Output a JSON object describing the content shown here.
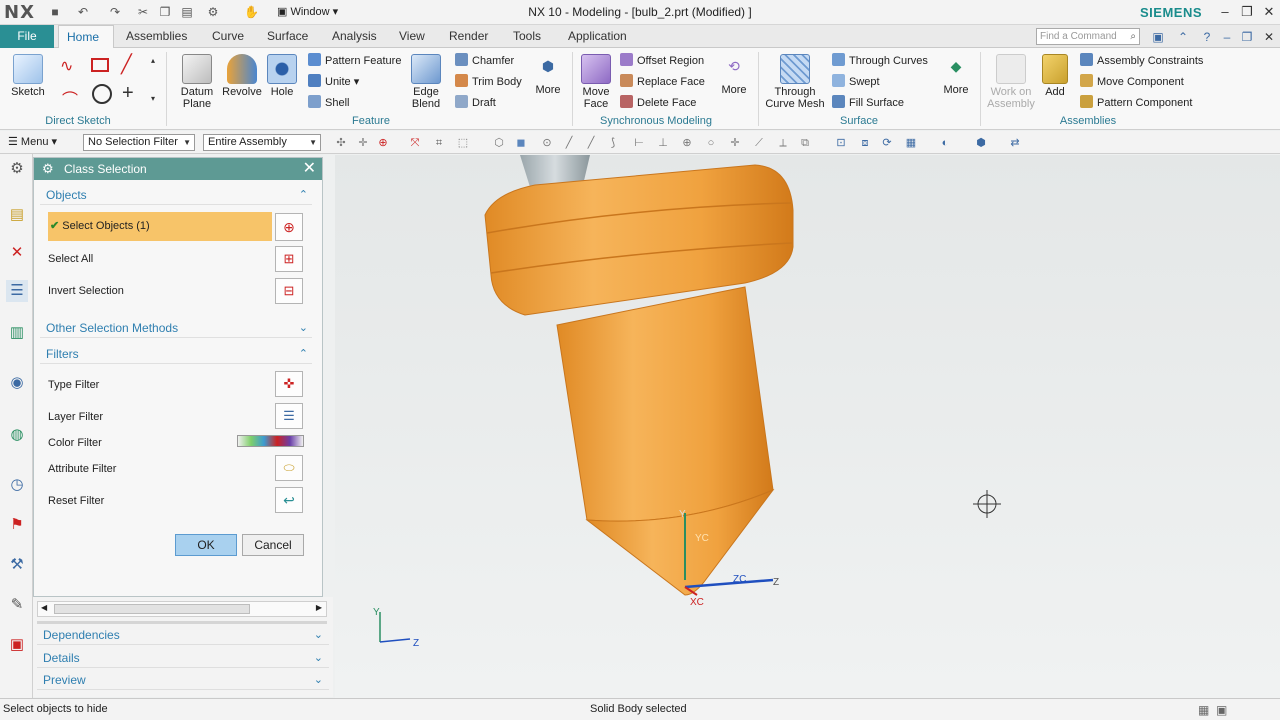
{
  "app": {
    "logo": "NX",
    "window_menu": "Window",
    "title": "NX 10 - Modeling - [bulb_2.prt (Modified) ]",
    "brand": "SIEMENS",
    "accent_color": "#2a8f94"
  },
  "tabs": {
    "file": "File",
    "items": [
      "Home",
      "Assemblies",
      "Curve",
      "Surface",
      "Analysis",
      "View",
      "Render",
      "Tools",
      "Application"
    ],
    "active": "Home",
    "command_finder_placeholder": "Find a Command"
  },
  "ribbon": {
    "direct_sketch": {
      "sketch": "Sketch",
      "group": "Direct Sketch"
    },
    "feature": {
      "datum_plane": "Datum Plane",
      "revolve": "Revolve",
      "hole": "Hole",
      "pattern_feature": "Pattern Feature",
      "unite": "Unite",
      "shell": "Shell",
      "edge_blend": "Edge Blend",
      "chamfer": "Chamfer",
      "trim_body": "Trim Body",
      "draft": "Draft",
      "more": "More",
      "group": "Feature"
    },
    "sync": {
      "move_face": "Move Face",
      "offset_region": "Offset Region",
      "replace_face": "Replace Face",
      "delete_face": "Delete Face",
      "more": "More",
      "group": "Synchronous Modeling"
    },
    "surface": {
      "through_curve_mesh": "Through Curve Mesh",
      "through_curves": "Through Curves",
      "swept": "Swept",
      "fill_surface": "Fill Surface",
      "more": "More",
      "group": "Surface"
    },
    "assemblies": {
      "work_on_assembly": "Work on Assembly",
      "add": "Add",
      "assembly_constraints": "Assembly Constraints",
      "move_component": "Move Component",
      "pattern_component": "Pattern Component",
      "group": "Assemblies"
    }
  },
  "selection_bar": {
    "menu": "Menu",
    "filter": "No Selection Filter",
    "scope": "Entire Assembly"
  },
  "dialog": {
    "title": "Class Selection",
    "objects_section": "Objects",
    "select_objects": "Select Objects (1)",
    "select_all": "Select All",
    "invert_selection": "Invert Selection",
    "other_methods": "Other Selection Methods",
    "filters_section": "Filters",
    "type_filter": "Type Filter",
    "layer_filter": "Layer Filter",
    "color_filter": "Color Filter",
    "attribute_filter": "Attribute Filter",
    "reset_filter": "Reset Filter",
    "ok": "OK",
    "cancel": "Cancel"
  },
  "panel": {
    "dependencies": "Dependencies",
    "details": "Details",
    "preview": "Preview"
  },
  "viewport": {
    "axis_labels": {
      "y": "Y",
      "z": "Z",
      "x": "XC",
      "zc": "ZC",
      "yc": "YC"
    },
    "model_color": "#f0a640"
  },
  "status": {
    "prompt": "Select objects to hide",
    "message": "Solid Body selected"
  }
}
